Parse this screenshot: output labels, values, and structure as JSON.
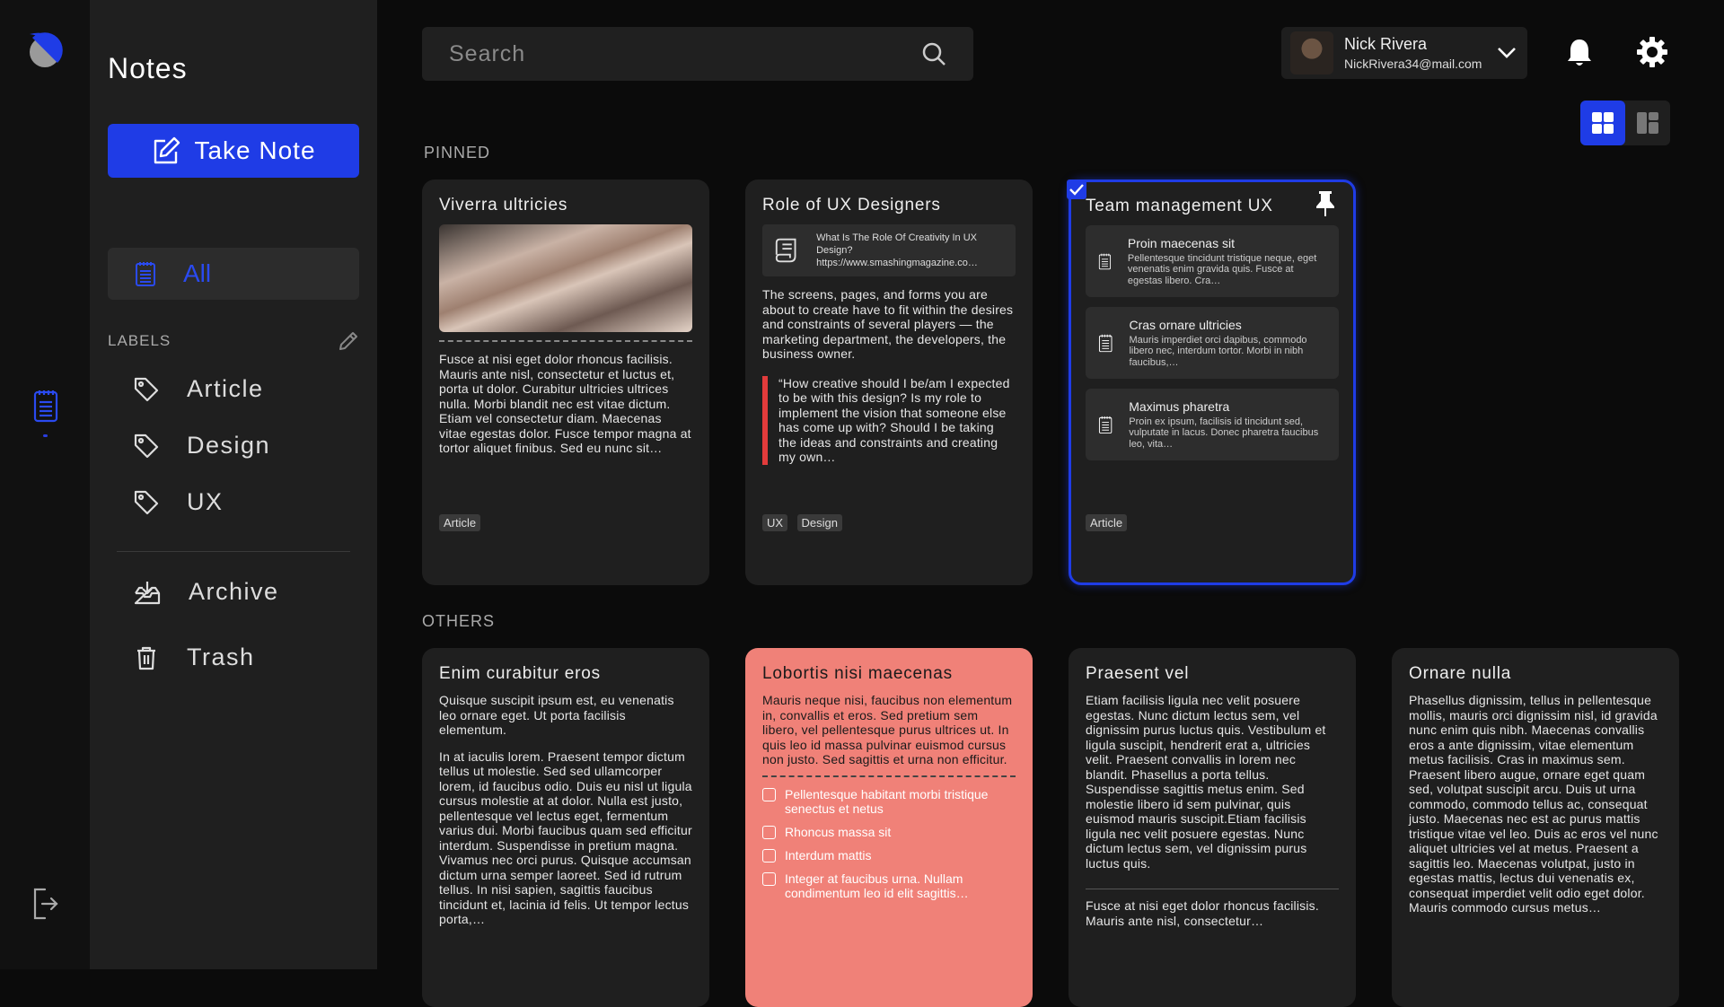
{
  "app": {
    "title": "Notes"
  },
  "sidebar": {
    "take_note": "Take Note",
    "all": "All",
    "labels_heading": "LABELS",
    "labels": [
      {
        "label": "Article"
      },
      {
        "label": "Design"
      },
      {
        "label": "UX"
      }
    ],
    "archive": "Archive",
    "trash": "Trash"
  },
  "search": {
    "placeholder": "Search"
  },
  "user": {
    "name": "Nick Rivera",
    "email": "NickRivera34@mail.com"
  },
  "sections": {
    "pinned": "PINNED",
    "others": "OTHERS"
  },
  "colors": {
    "accent": "#1f3ce6",
    "card": "#1f1f1f",
    "highlight_card": "#f08178",
    "quote_bar": "#e23b3b"
  },
  "pinned": [
    {
      "title": "Viverra ultricies",
      "text": "Fusce at nisi eget dolor rhoncus facilisis. Mauris ante nisl, consectetur et luctus et, porta ut dolor. Curabitur ultricies ultrices nulla. Morbi blandit nec est vitae dictum. Etiam vel consectetur diam. Maecenas vitae egestas dolor. Fusce tempor magna at tortor aliquet finibus. Sed eu nunc sit…",
      "tags": [
        "Article"
      ]
    },
    {
      "title": "Role of UX Designers",
      "link_title": "What Is The Role Of Creativity In UX Design?",
      "link_url": "https://www.smashingmagazine.co…",
      "text": "The screens, pages, and forms you are about to create have to fit within the desires and constraints of several players — the marketing department, the developers, the business owner.",
      "quote": "“How creative should I be/am I expected to be with this design? Is my role to implement the vision that someone else has come up with? Should I be taking the ideas and constraints and creating my own…",
      "tags": [
        "UX",
        "Design"
      ]
    },
    {
      "title": "Team management UX",
      "selected": true,
      "pinned": true,
      "subnotes": [
        {
          "title": "Proin maecenas sit",
          "text": "Pellentesque tincidunt tristique neque, eget venenatis enim gravida quis. Fusce at egestas libero. Cra…"
        },
        {
          "title": "Cras ornare ultricies",
          "text": "Mauris imperdiet orci dapibus, commodo libero nec, interdum tortor. Morbi in nibh faucibus,…"
        },
        {
          "title": "Maximus pharetra",
          "text": "Proin ex ipsum, facilisis id tincidunt sed, vulputate in lacus. Donec pharetra faucibus leo, vita…"
        }
      ],
      "tags": [
        "Article"
      ]
    }
  ],
  "others": [
    {
      "title": "Enim curabitur eros",
      "p1": "Quisque suscipit ipsum est, eu venenatis leo ornare eget. Ut porta facilisis elementum.",
      "p2": "In at iaculis lorem. Praesent tempor dictum tellus ut molestie. Sed sed ullamcorper lorem, id faucibus odio. Duis eu nisl ut ligula cursus molestie at at dolor. Nulla est justo, pellentesque vel lectus eget, fermentum varius dui. Morbi faucibus quam sed efficitur interdum. Suspendisse in pretium magna. Vivamus nec orci purus. Quisque accumsan dictum urna semper laoreet. Sed id rutrum tellus. In nisi sapien, sagittis faucibus tincidunt et, lacinia id felis. Ut tempor lectus porta,…"
    },
    {
      "title": "Lobortis nisi maecenas",
      "text": "Mauris neque nisi, faucibus non elementum in, convallis et eros. Sed pretium sem libero, vel pellentesque purus ultrices ut. In quis leo id massa pulvinar euismod cursus non justo. Sed sagittis et urna non efficitur.",
      "checklist": [
        {
          "label": "Pellentesque habitant morbi tristique senectus et netus",
          "checked": false
        },
        {
          "label": "Rhoncus massa sit",
          "checked": false
        },
        {
          "label": "Interdum mattis",
          "checked": false
        },
        {
          "label": "Integer at faucibus urna. Nullam condimentum leo id elit sagittis…",
          "checked": false
        }
      ]
    },
    {
      "title": "Praesent vel",
      "text": "Etiam facilisis ligula nec velit posuere egestas. Nunc dictum lectus sem, vel dignissim purus luctus quis. Vestibulum et ligula suscipit, hendrerit erat a, ultricies velit. Praesent convallis in lorem nec blandit. Phasellus a porta tellus. Suspendisse sagittis metus enim. Sed molestie libero id sem pulvinar, quis euismod mauris suscipit.Etiam facilisis ligula nec velit posuere egestas. Nunc dictum lectus sem, vel dignissim purus luctus quis.",
      "text2": "Fusce at nisi eget dolor rhoncus facilisis. Mauris ante nisl, consectetur…"
    },
    {
      "title": "Ornare nulla",
      "text": "Phasellus dignissim, tellus in pellentesque mollis, mauris orci dignissim nisl, id gravida nunc enim quis nibh. Maecenas convallis eros a ante dignissim, vitae elementum metus facilisis. Cras in maximus sem. Praesent libero augue, ornare eget quam sed, volutpat suscipit arcu. Duis ut urna commodo, commodo tellus ac, consequat justo. Maecenas nec est ac purus mattis tristique vitae vel leo. Duis ac eros vel nunc aliquet ultricies vel at metus. Praesent a sagittis leo. Maecenas volutpat, justo in egestas mattis, lectus dui venenatis ex, consequat imperdiet velit odio eget dolor. Mauris commodo cursus metus…"
    }
  ]
}
